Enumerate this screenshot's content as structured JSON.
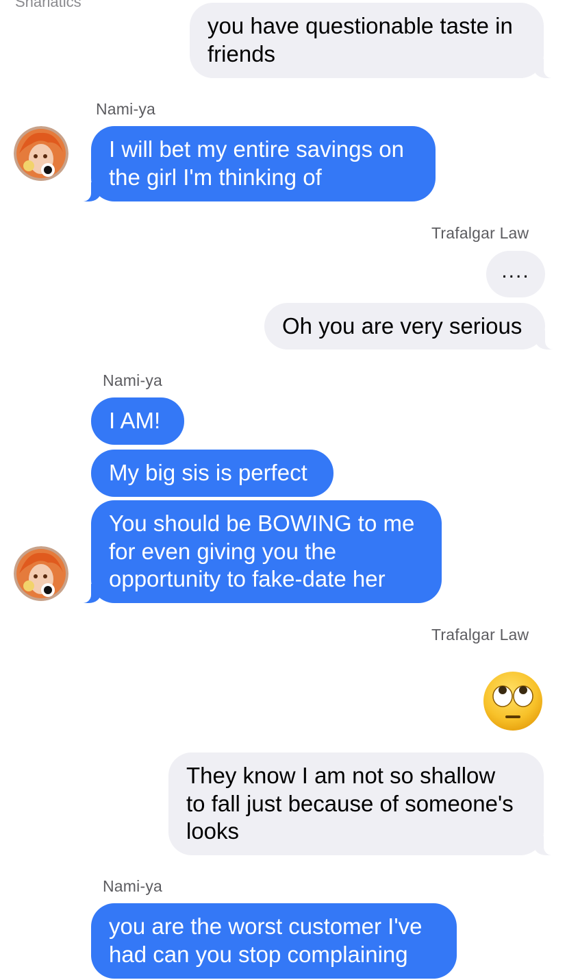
{
  "top_clipped_label": "Snarlatics",
  "messages": [
    {
      "id": "m1",
      "direction": "outgoing",
      "text": "you have questionable taste in\nfriends"
    },
    {
      "id": "m2",
      "direction": "incoming",
      "sender": "Nami-ya",
      "text": "I will bet my entire savings on\nthe girl I'm thinking of"
    },
    {
      "id": "m3",
      "direction": "outgoing",
      "sender": "Trafalgar Law",
      "text": "...."
    },
    {
      "id": "m4",
      "direction": "outgoing",
      "text": "Oh you are very serious"
    },
    {
      "id": "m5",
      "direction": "incoming",
      "sender": "Nami-ya",
      "text": "I AM!"
    },
    {
      "id": "m6",
      "direction": "incoming",
      "text": "My big sis is perfect"
    },
    {
      "id": "m7",
      "direction": "incoming",
      "text": "You should be BOWING to me\nfor even giving you the\nopportunity to fake-date her"
    },
    {
      "id": "m8",
      "direction": "outgoing",
      "sender": "Trafalgar Law",
      "emoji": "face-with-rolling-eyes"
    },
    {
      "id": "m9",
      "direction": "outgoing",
      "text": "They know I am not so shallow\nto fall just because of someone's\nlooks"
    },
    {
      "id": "m10",
      "direction": "incoming",
      "sender": "Nami-ya",
      "text": "you are the worst customer I've\nhad can you stop complaining"
    }
  ],
  "senders": {
    "s1": "Nami-ya",
    "s2": "Trafalgar Law",
    "s3": "Nami-ya",
    "s4": "Trafalgar Law",
    "s5": "Nami-ya"
  },
  "colors": {
    "incoming_bubble": "#3478f6",
    "outgoing_bubble": "#efeff4",
    "incoming_text": "#ffffff",
    "outgoing_text": "#000000",
    "sender_label": "#5c5c60"
  },
  "icons": {
    "avatar": "nami-avatar",
    "emoji": "face-with-rolling-eyes"
  }
}
